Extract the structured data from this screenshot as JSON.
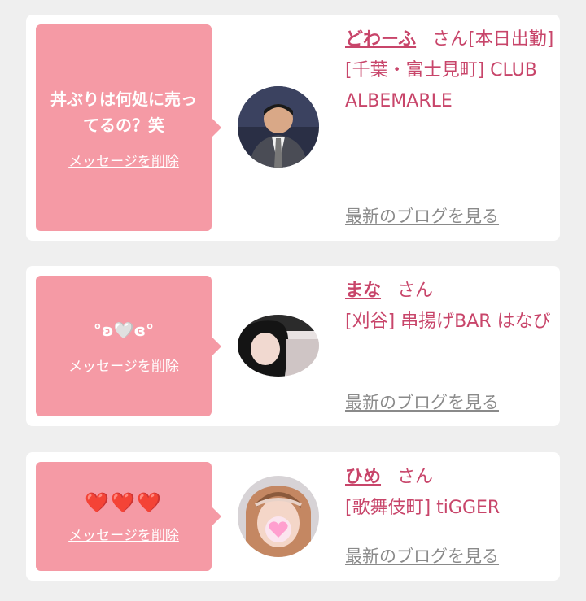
{
  "cards": [
    {
      "message": "丼ぶりは何処に売ってるの？笑",
      "delete_label": "メッセージを削除",
      "name": "どわーふ",
      "honorific": "さん",
      "status": "[本日出勤]",
      "shop": "[千葉・富士見町] CLUB ALBEMARLE",
      "blog_label": "最新のブログを見る"
    },
    {
      "message": "°ʚ🤍ɞ°",
      "delete_label": "メッセージを削除",
      "name": "まな",
      "honorific": "さん",
      "shop": "[刈谷] 串揚げBAR はなび",
      "blog_label": "最新のブログを見る"
    },
    {
      "message": "❤️❤️❤️",
      "delete_label": "メッセージを削除",
      "name": "ひめ",
      "honorific": "さん",
      "shop": "[歌舞伎町] tiGGER",
      "blog_label": "最新のブログを見る"
    }
  ],
  "colors": {
    "bubble": "#f59aa5",
    "accent": "#c8456a",
    "muted": "#8a8a8a",
    "background": "#efefef"
  }
}
